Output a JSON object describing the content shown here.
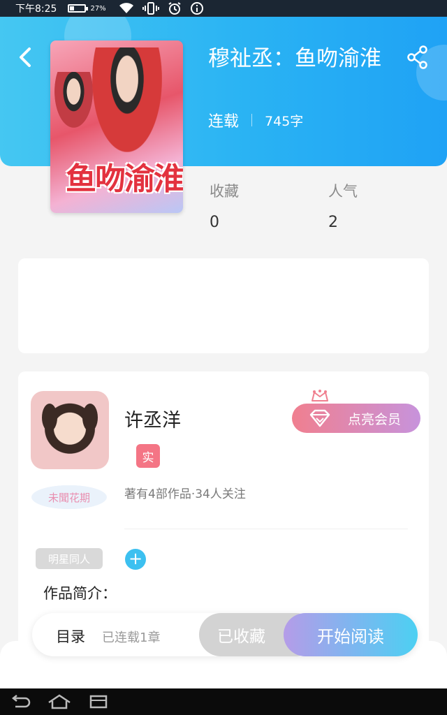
{
  "status_bar": {
    "time": "下午8:25",
    "battery_percent": "27%",
    "battery_level": 0.27
  },
  "book": {
    "title": "穆祉丞：鱼吻渝淮",
    "status": "连载",
    "word_count": "745字",
    "cover_text": "鱼吻渝淮"
  },
  "stats": {
    "favorites_label": "收藏",
    "favorites_value": "0",
    "popularity_label": "人气",
    "popularity_value": "2"
  },
  "author": {
    "name": "许丞洋",
    "verified_badge": "实",
    "title_badge": "未聞花期",
    "summary": "著有4部作品·34人关注",
    "vip_button": "点亮会员"
  },
  "tags": {
    "genre": "明星同人",
    "add": "+"
  },
  "intro": {
    "label": "作品简介："
  },
  "action_bar": {
    "toc_label": "目录",
    "toc_status": "已连载1章",
    "collect_button": "已收藏",
    "read_button": "开始阅读"
  },
  "colors": {
    "header_start": "#45c7f2",
    "header_end": "#1fa2f5",
    "vip_start": "#f07f8f",
    "vip_end": "#c793dc",
    "read_start": "#b59ce8",
    "read_end": "#4cd0f2",
    "verified_badge": "#f47585"
  },
  "icons": {
    "back": "chevron-left-icon",
    "share": "share-icon",
    "vip": "diamond-icon",
    "crown": "crown-icon",
    "nav_back": "back-arrow-icon",
    "nav_home": "home-icon",
    "nav_recent": "recent-apps-icon"
  }
}
